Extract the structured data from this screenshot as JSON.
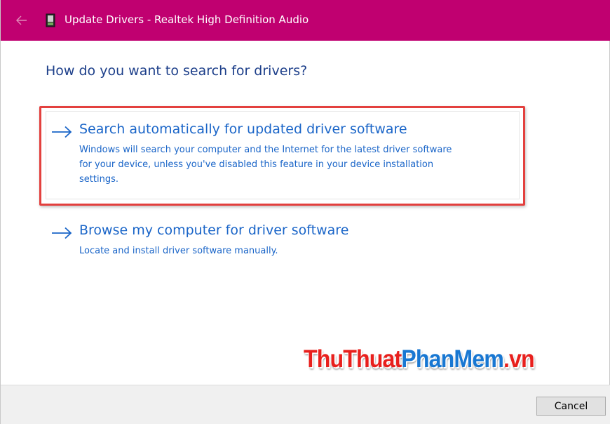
{
  "window": {
    "title": "Update Drivers - Realtek High Definition Audio",
    "titlebar_color": "#c00070",
    "back_icon": "back-arrow-icon",
    "app_icon": "device-manager-icon"
  },
  "main": {
    "question": "How do you want to search for drivers?",
    "options": [
      {
        "title": "Search automatically for updated driver software",
        "description_lines": [
          "Windows will search your computer and the Internet for the latest driver software",
          "for your device, unless you've disabled this feature in your device installation",
          "settings."
        ],
        "icon": "right-arrow-icon",
        "highlighted": true
      },
      {
        "title": "Browse my computer for driver software",
        "description_lines": [
          "Locate and install driver software manually."
        ],
        "icon": "right-arrow-icon",
        "highlighted": false
      }
    ],
    "link_color": "#1a65c8",
    "highlight_color": "#e3403e"
  },
  "watermark": {
    "part1": "ThuThuat",
    "part2": "PhanMem",
    "part3": ".vn"
  },
  "footer": {
    "cancel_label": "Cancel"
  }
}
